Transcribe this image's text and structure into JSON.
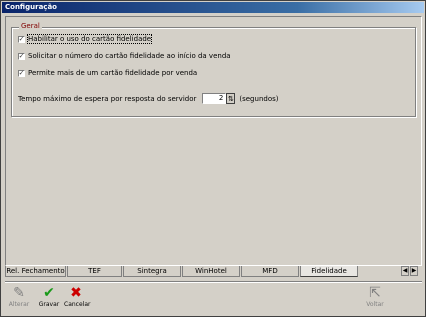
{
  "window": {
    "title": "Configuração"
  },
  "group": {
    "legend": "Geral",
    "checkboxes": [
      {
        "label": "Habilitar o uso do cartão fidelidade",
        "checked": true
      },
      {
        "label": "Solicitar o número do cartão fidelidade ao início da venda",
        "checked": true
      },
      {
        "label": "Permite mais de um cartão fidelidade por venda",
        "checked": true
      }
    ],
    "timeout": {
      "label": "Tempo máximo de espera por resposta do servidor",
      "value": "2",
      "unit": "(segundos)"
    }
  },
  "tabs": [
    "Rel. Fechamento",
    "TEF",
    "Sintegra",
    "WinHotel",
    "MFD",
    "Fidelidade"
  ],
  "active_tab": "Fidelidade",
  "toolbar": {
    "alterar": "Alterar",
    "gravar": "Gravar",
    "cancelar": "Cancelar",
    "voltar": "Voltar"
  },
  "colors": {
    "legend": "#800000",
    "gravar_icon": "#1a9a1a",
    "cancelar_icon": "#cc0000"
  }
}
